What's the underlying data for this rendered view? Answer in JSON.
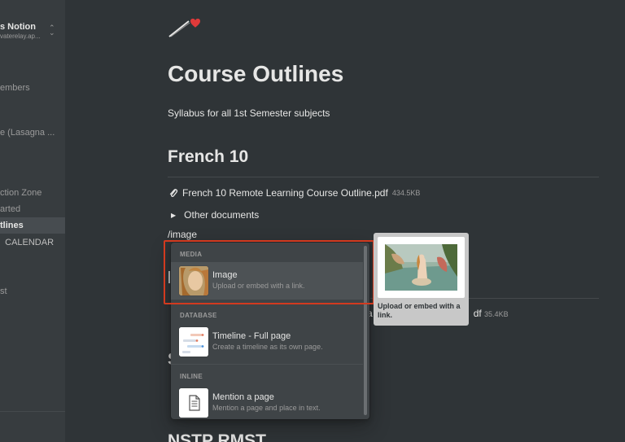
{
  "sidebar": {
    "workspace_name": "s Notion",
    "workspace_email": "vaterelay.ap...",
    "items": [
      {
        "label": "embers"
      },
      {
        "label": "e (Lasagna ..."
      },
      {
        "label": "ction Zone"
      },
      {
        "label": "arted"
      },
      {
        "label": "tlines"
      },
      {
        "label": "CALENDAR"
      },
      {
        "label": "st"
      }
    ]
  },
  "page": {
    "title": "Course Outlines",
    "description": "Syllabus for all 1st Semester subjects",
    "section_heading": "French 10",
    "file_name": "French 10 Remote Learning Course Outline.pdf",
    "file_size": "434.5KB",
    "toggle_label": "Other documents",
    "slash_input": "/image",
    "bg_file_tail": "df",
    "bg_file_size": "35.4KB",
    "bg_partial_letter": "a",
    "bg_s_heading": "S",
    "bg_bottom_heading": "NSTP RMST"
  },
  "menu": {
    "sections": {
      "media": "MEDIA",
      "database": "DATABASE",
      "inline": "INLINE"
    },
    "items": [
      {
        "title": "Image",
        "subtitle": "Upload or embed with a link."
      },
      {
        "title": "Timeline - Full page",
        "subtitle": "Create a timeline as its own page."
      },
      {
        "title": "Mention a page",
        "subtitle": "Mention a page and place in text."
      }
    ]
  },
  "preview": {
    "caption": "Upload or embed with a link."
  },
  "colors": {
    "background": "#2f3437",
    "sidebar": "#373c3f",
    "menu": "#3f4447",
    "highlight": "#d23a1f"
  }
}
